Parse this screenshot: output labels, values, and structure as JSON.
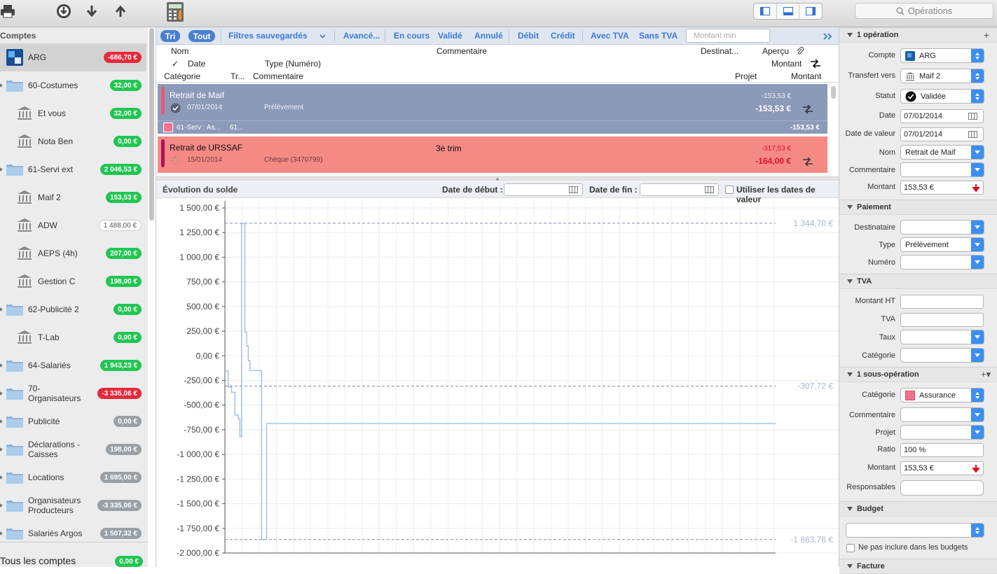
{
  "toolbar": {
    "search_placeholder": "Opérations"
  },
  "sidebar": {
    "title": "Comptes",
    "items": [
      {
        "label": "ARG",
        "amount": "-686,70 €",
        "kind": "bank",
        "color": "red"
      },
      {
        "label": "60-Costumes",
        "amount": "32,00 €",
        "kind": "folder",
        "color": "green"
      },
      {
        "label": "Et vous",
        "amount": "32,00 €",
        "kind": "bank",
        "color": "green"
      },
      {
        "label": "Nota Ben",
        "amount": "0,00 €",
        "kind": "bank",
        "color": "green"
      },
      {
        "label": "61-Servi ext",
        "amount": "2 046,53 €",
        "kind": "folder",
        "color": "green"
      },
      {
        "label": "Maif 2",
        "amount": "153,53 €",
        "kind": "bank",
        "color": "green"
      },
      {
        "label": "ADW",
        "amount": "1 488,00 €",
        "kind": "bank",
        "color": "white"
      },
      {
        "label": "AEPS (4h)",
        "amount": "207,00 €",
        "kind": "bank",
        "color": "green"
      },
      {
        "label": "Gestion C",
        "amount": "198,00 €",
        "kind": "bank",
        "color": "green"
      },
      {
        "label": "62-Publicité 2",
        "amount": "0,00 €",
        "kind": "folder",
        "color": "green"
      },
      {
        "label": "T-Lab",
        "amount": "0,00 €",
        "kind": "bank",
        "color": "green"
      },
      {
        "label": "64-Salariés",
        "amount": "1 943,23 €",
        "kind": "folder",
        "color": "green"
      },
      {
        "label": "70-\nOrganisateurs",
        "amount": "-3 335,06 €",
        "kind": "folder",
        "color": "red"
      },
      {
        "label": "Publicité",
        "amount": "0,00 €",
        "kind": "folder",
        "color": "grey"
      },
      {
        "label": "Déclarations -\nCaisses",
        "amount": "198,00 €",
        "kind": "folder",
        "color": "grey"
      },
      {
        "label": "Locations",
        "amount": "1 695,00 €",
        "kind": "folder",
        "color": "grey"
      },
      {
        "label": "Organisateurs\nProducteurs",
        "amount": "-3 335,06 €",
        "kind": "folder",
        "color": "grey"
      },
      {
        "label": "Salariés Argos",
        "amount": "1 507,32 €",
        "kind": "folder",
        "color": "grey"
      }
    ],
    "total_label": "Tous les comptes",
    "total_amount": "0,00 €"
  },
  "filters": {
    "tri": "Tri",
    "tout": "Tout",
    "saved": "Filtres sauvegardés",
    "advanced": "Avancé...",
    "en_cours": "En cours",
    "valide": "Validé",
    "annule": "Annulé",
    "debit": "Débit",
    "credit": "Crédit",
    "avec_tva": "Avec TVA",
    "sans_tva": "Sans TVA",
    "montant_min": "Montant min"
  },
  "columns": {
    "nom": "Nom",
    "commentaire": "Commentaire",
    "destinat": "Destinat...",
    "apercu": "Aperçu",
    "check": "✓",
    "date": "Date",
    "type": "Type (Numéro)",
    "montant": "Montant",
    "categorie": "Catégorie",
    "tr": "Tr...",
    "commentaire2": "Commentaire",
    "projet": "Projet",
    "montant2": "Montant"
  },
  "transactions": [
    {
      "name": "Retrait de Maif",
      "date": "07/01/2014",
      "type": "Prélèvement",
      "amount_small": "-153,53 €",
      "amount": "-153,53 €",
      "comment": "",
      "sub": "61-Serv : As...",
      "sub2": "61...",
      "sub_amount": "-153,53 €"
    },
    {
      "name": "Retrait de URSSAF",
      "date": "15/01/2014",
      "type": "Chèque (3470799)",
      "amount_small": "-317,53 €",
      "amount": "-164,00 €",
      "comment": "3è trim"
    }
  ],
  "chart_header": {
    "title": "Évolution du solde",
    "start_label": "Date de début :",
    "end_label": "Date de fin :",
    "value_dates": "Utiliser les dates de valeur"
  },
  "chart_data": {
    "type": "line",
    "y_ticks": [
      "1 500,00 €",
      "1 250,00 €",
      "1 000,00 €",
      "750,00 €",
      "500,00 €",
      "250,00 €",
      "0,00 €",
      "-250,00 €",
      "-500,00 €",
      "-750,00 €",
      "-1 000,00 €",
      "-1 250,00 €",
      "-1 500,00 €",
      "-1 750,00 €",
      "-2 000,00 €"
    ],
    "ylim": [
      -2000,
      1500
    ],
    "reference_lines": [
      {
        "value": 1344.7,
        "label": "1 344,70 €"
      },
      {
        "value": -307.72,
        "label": "-307,72 €"
      },
      {
        "value": -1863.76,
        "label": "-1 863,76 €"
      }
    ],
    "series": [
      {
        "color": "#8fbde8",
        "points": [
          [
            0,
            -153.53
          ],
          [
            2,
            -153.53
          ],
          [
            2,
            -317.53
          ],
          [
            4,
            -317.53
          ],
          [
            4,
            -370
          ],
          [
            6,
            -370
          ],
          [
            6,
            -600
          ],
          [
            8,
            -600
          ],
          [
            8,
            -640
          ],
          [
            9,
            -640
          ],
          [
            9,
            -820
          ],
          [
            10,
            -820
          ],
          [
            10,
            1340
          ],
          [
            11,
            1340
          ],
          [
            11,
            1340
          ],
          [
            12,
            1340
          ],
          [
            12,
            240
          ],
          [
            13,
            240
          ],
          [
            13,
            100
          ],
          [
            14,
            100
          ],
          [
            14,
            -50
          ],
          [
            15,
            -50
          ],
          [
            15,
            -150
          ],
          [
            22,
            -150
          ],
          [
            22,
            -1863.76
          ],
          [
            25,
            -1863.76
          ],
          [
            25,
            -686.7
          ],
          [
            330,
            -686.7
          ]
        ]
      }
    ]
  },
  "right_panel": {
    "section_operation": "1 opération",
    "compte_label": "Compte",
    "compte_value": "ARG",
    "transfert_label": "Transfert vers",
    "transfert_value": "Maif 2",
    "statut_label": "Statut",
    "statut_value": "Validée",
    "date_label": "Date",
    "date_value": "07/01/2014",
    "date_valeur_label": "Date de valeur",
    "date_valeur_value": "07/01/2014",
    "nom_label": "Nom",
    "nom_value": "Retrait de Maif",
    "commentaire_label": "Commentaire",
    "montant_label": "Montant",
    "montant_value": "153,53 €",
    "section_paiement": "Paiement",
    "destinataire_label": "Destinataire",
    "type_label": "Type",
    "type_value": "Prélèvement",
    "numero_label": "Numéro",
    "section_tva": "TVA",
    "montant_ht_label": "Montant HT",
    "tva_label": "TVA",
    "taux_label": "Taux",
    "categorie_label": "Catégorie",
    "section_sous_op": "1 sous-opération",
    "sub_categorie_label": "Catégorie",
    "sub_categorie_value": "Assurance",
    "sub_commentaire_label": "Commentaire",
    "projet_label": "Projet",
    "ratio_label": "Ratio",
    "ratio_value": "100 %",
    "sub_montant_label": "Montant",
    "sub_montant_value": "153,53 €",
    "responsables_label": "Responsables",
    "section_budget": "Budget",
    "budget_checkbox": "Ne pas inclure dans les budgets",
    "section_facture": "Facture"
  }
}
